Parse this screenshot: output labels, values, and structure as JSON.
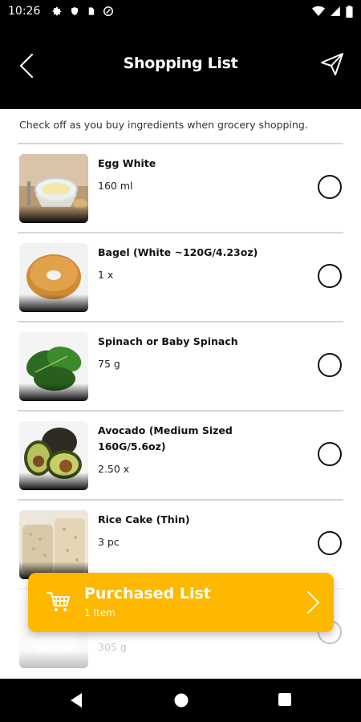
{
  "status_bar": {
    "time": "10:26"
  },
  "app_bar": {
    "title": "Shopping List"
  },
  "intro": "Check off as you buy ingredients when grocery shopping.",
  "items": [
    {
      "name": "Egg White",
      "qty": "160 ml",
      "image": "egg-white-photo"
    },
    {
      "name": "Bagel (White ~120G/4.23oz)",
      "qty": "1 x",
      "image": "bagel-photo"
    },
    {
      "name": "Spinach or Baby Spinach",
      "qty": "75 g",
      "image": "spinach-photo"
    },
    {
      "name": "Avocado (Medium Sized 160G/5.6oz)",
      "qty": "2.50 x",
      "image": "avocado-photo"
    },
    {
      "name": "Rice Cake (Thin)",
      "qty": "3 pc",
      "image": "rice-cake-photo"
    },
    {
      "name": "",
      "qty": "305 g",
      "image": "partially-hidden-photo"
    }
  ],
  "purchased": {
    "label": "Purchased List",
    "count": "1 Item"
  },
  "colors": {
    "accent": "#FFB800",
    "bar": "#000000"
  }
}
